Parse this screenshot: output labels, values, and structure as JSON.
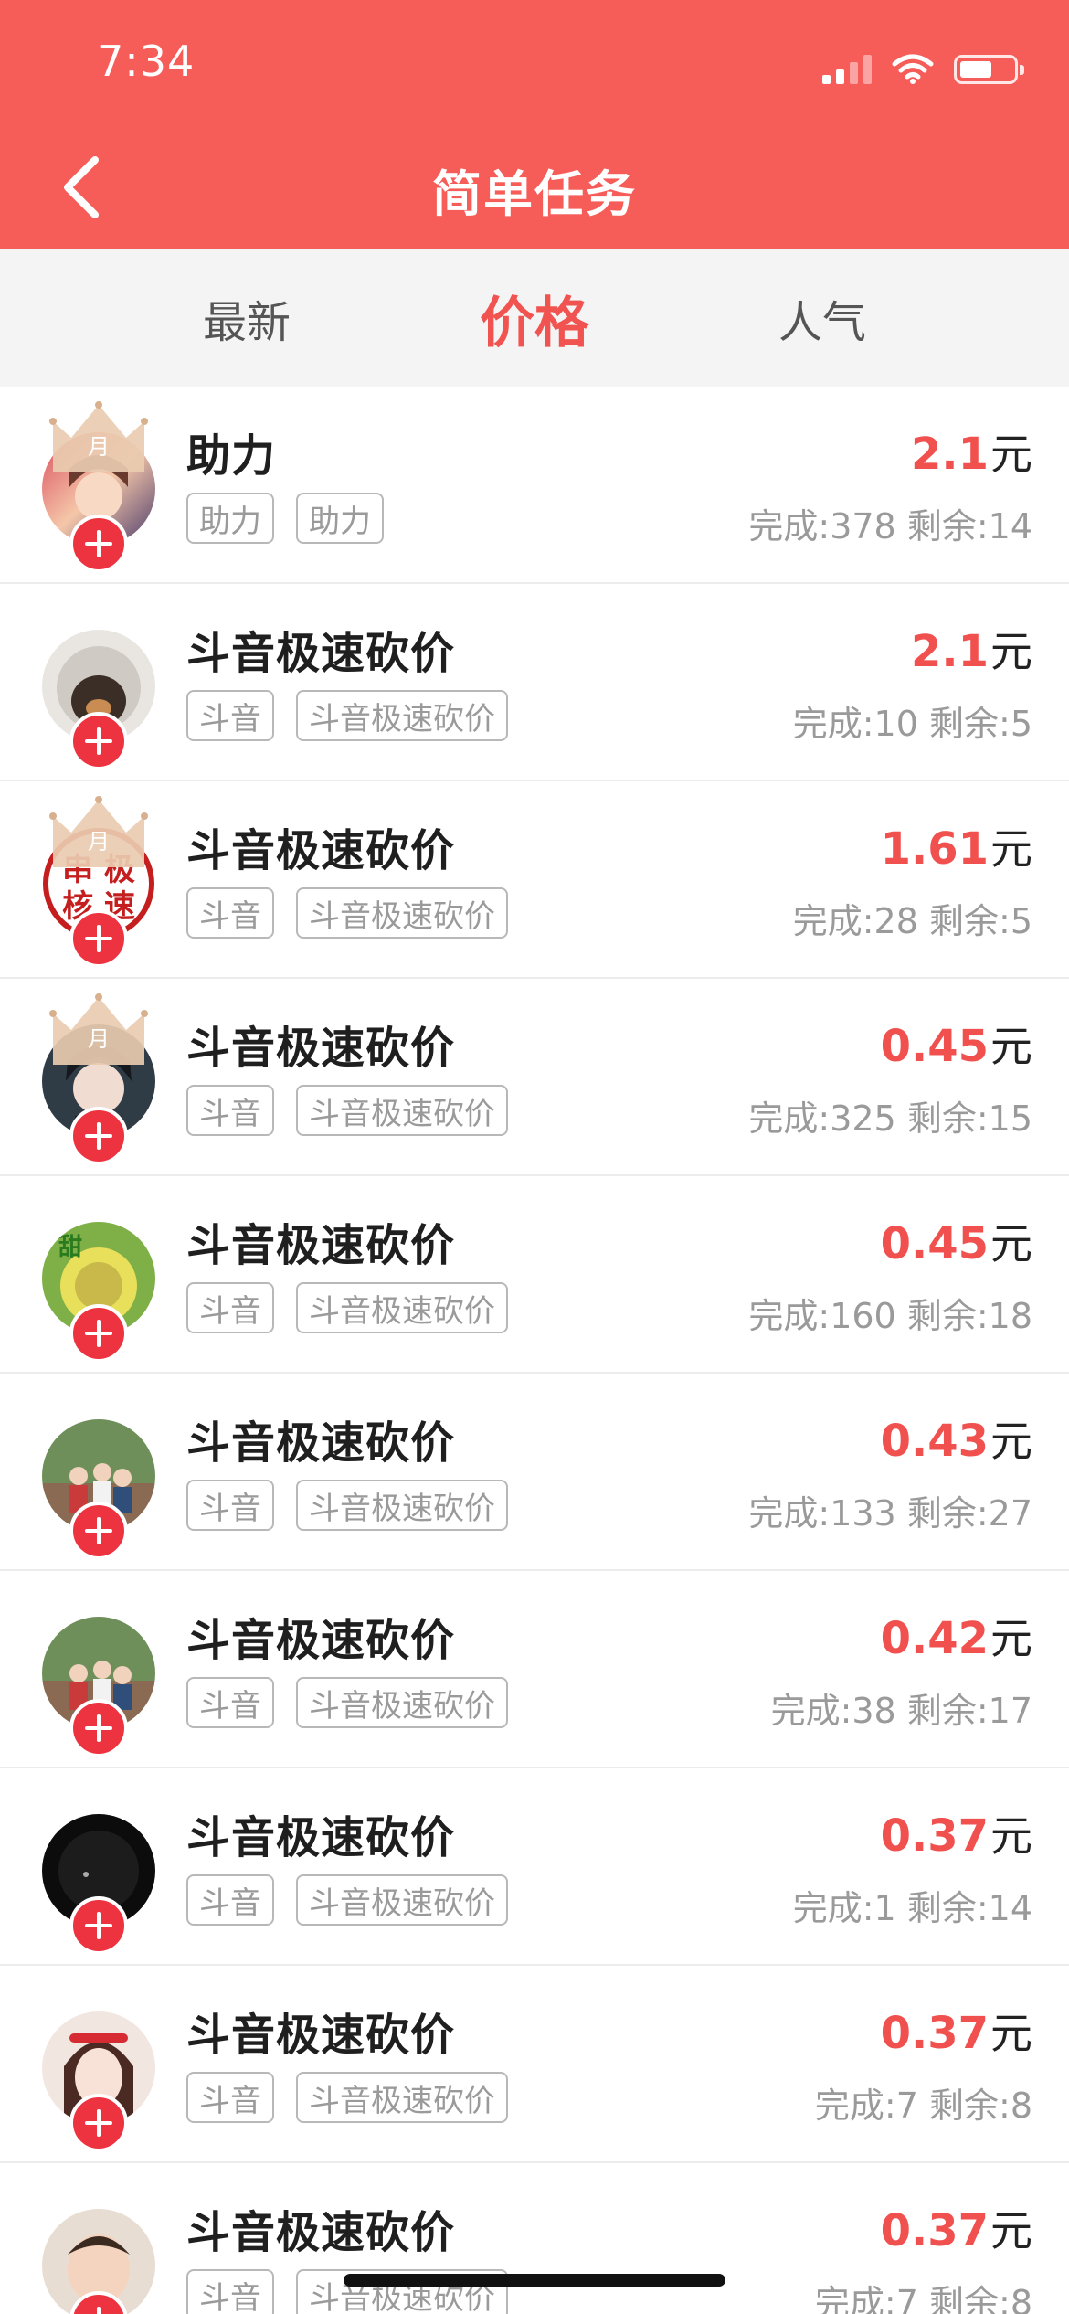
{
  "status_bar": {
    "time": "7:34"
  },
  "header": {
    "title": "简单任务"
  },
  "tabs": [
    {
      "label": "最新",
      "active": false
    },
    {
      "label": "价格",
      "active": true
    },
    {
      "label": "人气",
      "active": false
    }
  ],
  "crown_label": "月",
  "stats_done_label": "完成:",
  "stats_remaining_label": "剩余:",
  "currency_unit": "元",
  "colors": {
    "header": "#f65c58",
    "accent": "#f0504e",
    "plus_badge": "#ee3340"
  },
  "tasks": [
    {
      "title": "助力",
      "tags": [
        "助力",
        "助力"
      ],
      "price": "2.1",
      "done": "378",
      "remaining": "14",
      "crown": true,
      "avatar": "anime-girl"
    },
    {
      "title": "斗音极速砍价",
      "tags": [
        "斗音",
        "斗音极速砍价"
      ],
      "price": "2.1",
      "done": "10",
      "remaining": "5",
      "crown": false,
      "avatar": "dog-hood"
    },
    {
      "title": "斗音极速砍价",
      "tags": [
        "斗音",
        "斗音极速砍价"
      ],
      "price": "1.61",
      "done": "28",
      "remaining": "5",
      "crown": true,
      "avatar": "text-seal"
    },
    {
      "title": "斗音极速砍价",
      "tags": [
        "斗音",
        "斗音极速砍价"
      ],
      "price": "0.45",
      "done": "325",
      "remaining": "15",
      "crown": true,
      "avatar": "anime-boy"
    },
    {
      "title": "斗音极速砍价",
      "tags": [
        "斗音",
        "斗音极速砍价"
      ],
      "price": "0.45",
      "done": "160",
      "remaining": "18",
      "crown": false,
      "avatar": "food"
    },
    {
      "title": "斗音极速砍价",
      "tags": [
        "斗音",
        "斗音极速砍价"
      ],
      "price": "0.43",
      "done": "133",
      "remaining": "27",
      "crown": false,
      "avatar": "group-photo"
    },
    {
      "title": "斗音极速砍价",
      "tags": [
        "斗音",
        "斗音极速砍价"
      ],
      "price": "0.42",
      "done": "38",
      "remaining": "17",
      "crown": false,
      "avatar": "group-photo"
    },
    {
      "title": "斗音极速砍价",
      "tags": [
        "斗音",
        "斗音极速砍价"
      ],
      "price": "0.37",
      "done": "1",
      "remaining": "14",
      "crown": false,
      "avatar": "dark"
    },
    {
      "title": "斗音极速砍价",
      "tags": [
        "斗音",
        "斗音极速砍价"
      ],
      "price": "0.37",
      "done": "7",
      "remaining": "8",
      "crown": false,
      "avatar": "girl-portrait"
    },
    {
      "title": "斗音极速砍价",
      "tags": [
        "斗音",
        "斗音极速砍价"
      ],
      "price": "0.37",
      "done": "7",
      "remaining": "8",
      "crown": false,
      "avatar": "child"
    }
  ]
}
